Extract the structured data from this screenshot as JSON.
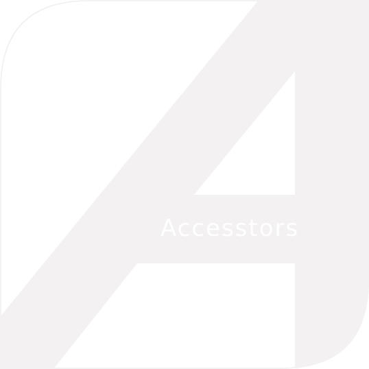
{
  "logo": {
    "wordmark": "Accesstors",
    "colors": {
      "background": "#ffffff",
      "shape": "#f3f1f2",
      "outline": "#eeeeee",
      "text": "#ffffff"
    }
  }
}
